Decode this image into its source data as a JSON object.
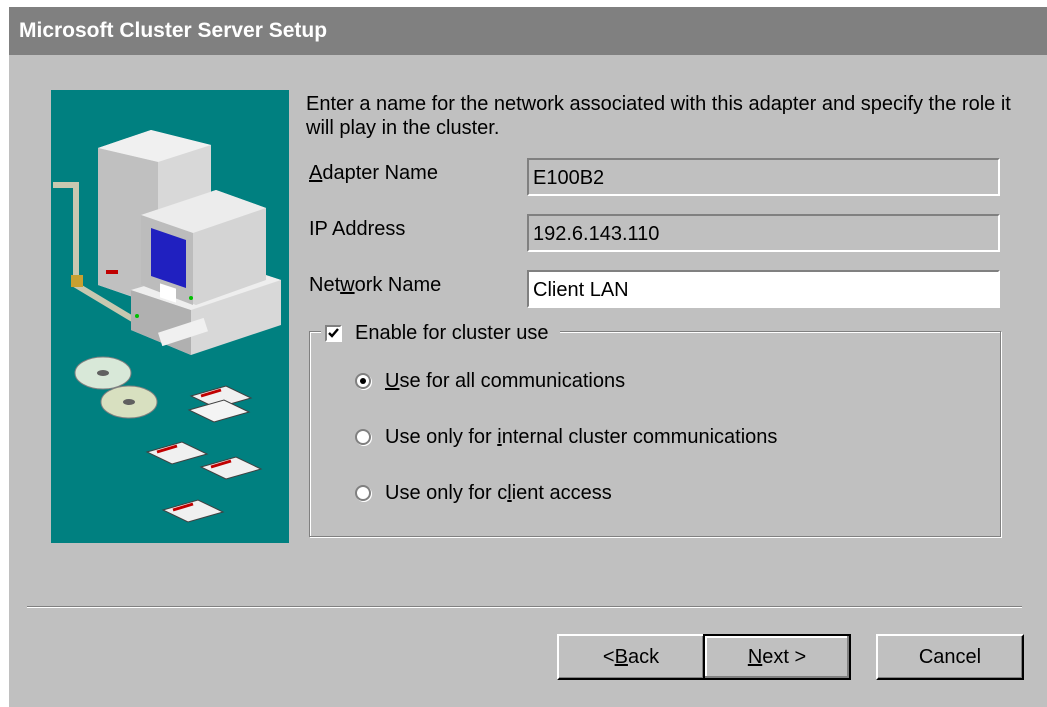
{
  "window": {
    "title": "Microsoft Cluster Server Setup"
  },
  "intro_text": "Enter a name for the network associated with this adapter and specify the role it will play in the cluster.",
  "fields": {
    "adapter_name": {
      "label_pre": "",
      "label_u": "A",
      "label_post": "dapter Name",
      "value": "E100B2"
    },
    "ip_address": {
      "label": "IP Address",
      "value": "192.6.143.110"
    },
    "network_name": {
      "label_pre": "Net",
      "label_u": "w",
      "label_post": "ork Name",
      "value": "Client LAN"
    }
  },
  "cluster_group": {
    "checkbox_label": "Enable for cluster use",
    "checked": true,
    "options": [
      {
        "pre": "",
        "u": "U",
        "post": "se for all communications",
        "selected": true
      },
      {
        "pre": "Use only for ",
        "u": "i",
        "post": "nternal cluster communications",
        "selected": false
      },
      {
        "pre": "Use only for c",
        "u": "l",
        "post": "ient access",
        "selected": false
      }
    ]
  },
  "buttons": {
    "back": {
      "pre": "< ",
      "u": "B",
      "post": "ack"
    },
    "next": {
      "pre": "",
      "u": "N",
      "post": "ext >"
    },
    "cancel": {
      "label": "Cancel"
    }
  },
  "icons": [
    "computer-illustration",
    "cd-disc-icon",
    "floppy-disk-icon"
  ],
  "colors": {
    "dialog": "#c0c0c0",
    "titlebar": "#808080",
    "illustration_bg": "#008080"
  }
}
